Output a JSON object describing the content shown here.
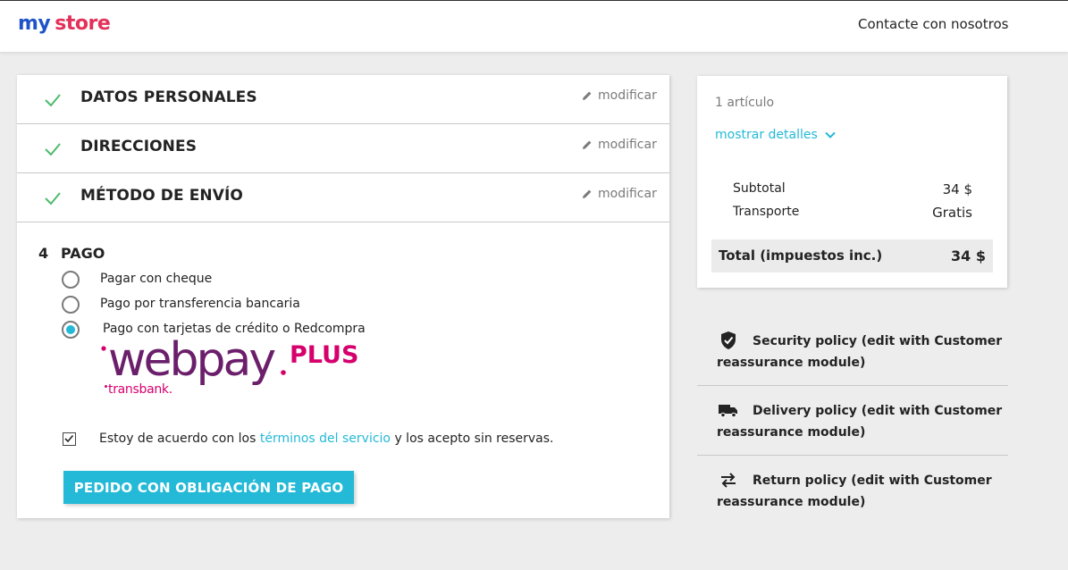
{
  "header": {
    "logo_word1": "my",
    "logo_word2": "store",
    "contact_link": "Contacte con nosotros"
  },
  "checkout": {
    "completed_steps": [
      {
        "title": "DATOS PERSONALES",
        "edit_label": "modificar"
      },
      {
        "title": "DIRECCIONES",
        "edit_label": "modificar"
      },
      {
        "title": "MÉTODO DE ENVÍO",
        "edit_label": "modificar"
      }
    ],
    "payment": {
      "step_number": "4",
      "title": "PAGO",
      "options": [
        {
          "label": "Pagar con cheque",
          "selected": false
        },
        {
          "label": "Pago por transferencia bancaria",
          "selected": false
        },
        {
          "label": "Pago con tarjetas de crédito o Redcompra",
          "selected": true
        }
      ],
      "logo": {
        "brand": "webpay",
        "suffix": "PLUS",
        "sub": "transbank."
      },
      "terms": {
        "before": "Estoy de acuerdo con los ",
        "link": "términos del servicio",
        "after": " y los acepto sin reservas.",
        "checked": true
      },
      "submit_label": "PEDIDO CON OBLIGACIÓN DE PAGO"
    }
  },
  "summary": {
    "item_count": "1 artículo",
    "details_toggle": "mostrar detalles",
    "subtotal_label": "Subtotal",
    "subtotal_value": "34 $",
    "shipping_label": "Transporte",
    "shipping_value": "Gratis",
    "total_label": "Total (impuestos inc.)",
    "total_value": "34 $"
  },
  "reassurance": [
    {
      "icon": "shield-check-icon",
      "text": "Security policy (edit with Customer reassurance module)"
    },
    {
      "icon": "truck-icon",
      "text": "Delivery policy (edit with Customer reassurance module)"
    },
    {
      "icon": "swap-arrows-icon",
      "text": "Return policy (edit with Customer reassurance module)"
    }
  ],
  "colors": {
    "accent": "#24b9d7",
    "check_green": "#4cbb6c",
    "logo_blue": "#1e54c8",
    "logo_red": "#e3315a",
    "webpay_purple": "#6b1f6b",
    "webpay_magenta": "#d6006d"
  }
}
